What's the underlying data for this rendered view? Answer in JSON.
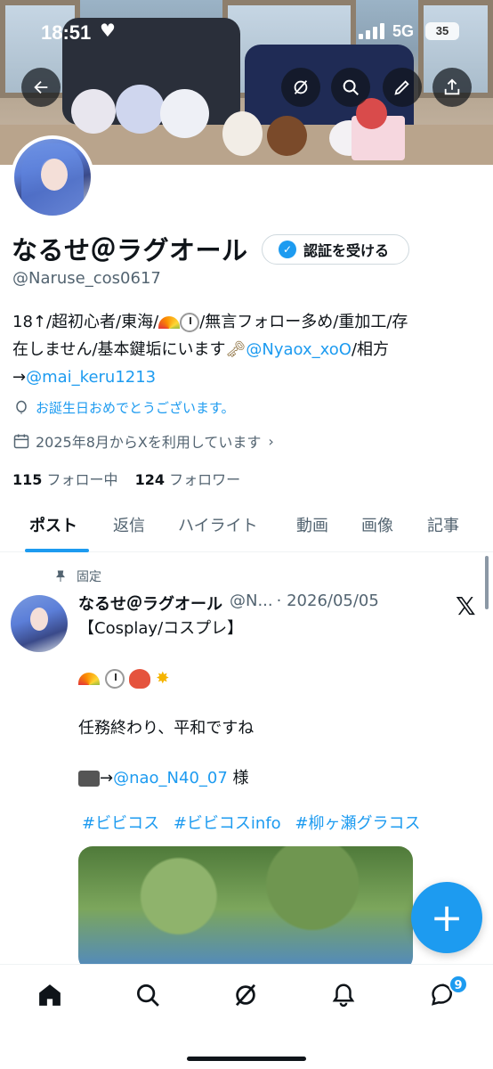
{
  "status_bar": {
    "time": "18:51",
    "network": "5G",
    "battery": "35"
  },
  "profile": {
    "name": "なるせ＠ラグオール",
    "verify_label": "認証を受ける",
    "handle": "@Naruse_cos0617",
    "bio": {
      "line1": "18↑/超初心者/東海/",
      "line1b": "/無言フォロー多め/重加工/存",
      "line2a": "在しません/基本鍵垢にいます",
      "mention1": "@Nyaox_xoO",
      "line2b": "/相方",
      "line3a": "→",
      "mention2": "@mai_keru1213"
    },
    "birthday": "お誕生日おめでとうございます。",
    "joined": "2025年8月からXを利用しています",
    "following_count": "115",
    "following_label": "フォロー中",
    "followers_count": "124",
    "followers_label": "フォロワー"
  },
  "tabs": [
    {
      "label": "ポスト"
    },
    {
      "label": "返信"
    },
    {
      "label": "ハイライト"
    },
    {
      "label": "動画"
    },
    {
      "label": "画像"
    },
    {
      "label": "記事"
    }
  ],
  "post": {
    "pinned_label": "固定",
    "author_name": "なるせ＠ラグオール",
    "author_handle": "@N...",
    "date": "· 2026/05/05",
    "line1": "【Cosplay/コスプレ】",
    "line3": "任務終わり、平和ですね",
    "credit_arrow": "→",
    "credit_mention": "@nao_N40_07",
    "credit_suffix": " 様",
    "hashtags": [
      "#ビビコス",
      "#ビビコスinfo",
      "#柳ヶ瀬グラコス"
    ]
  },
  "navbar": {
    "notifications_badge": "9"
  },
  "colors": {
    "accent": "#1d9bf0",
    "text": "#0f1419",
    "muted": "#536471"
  }
}
